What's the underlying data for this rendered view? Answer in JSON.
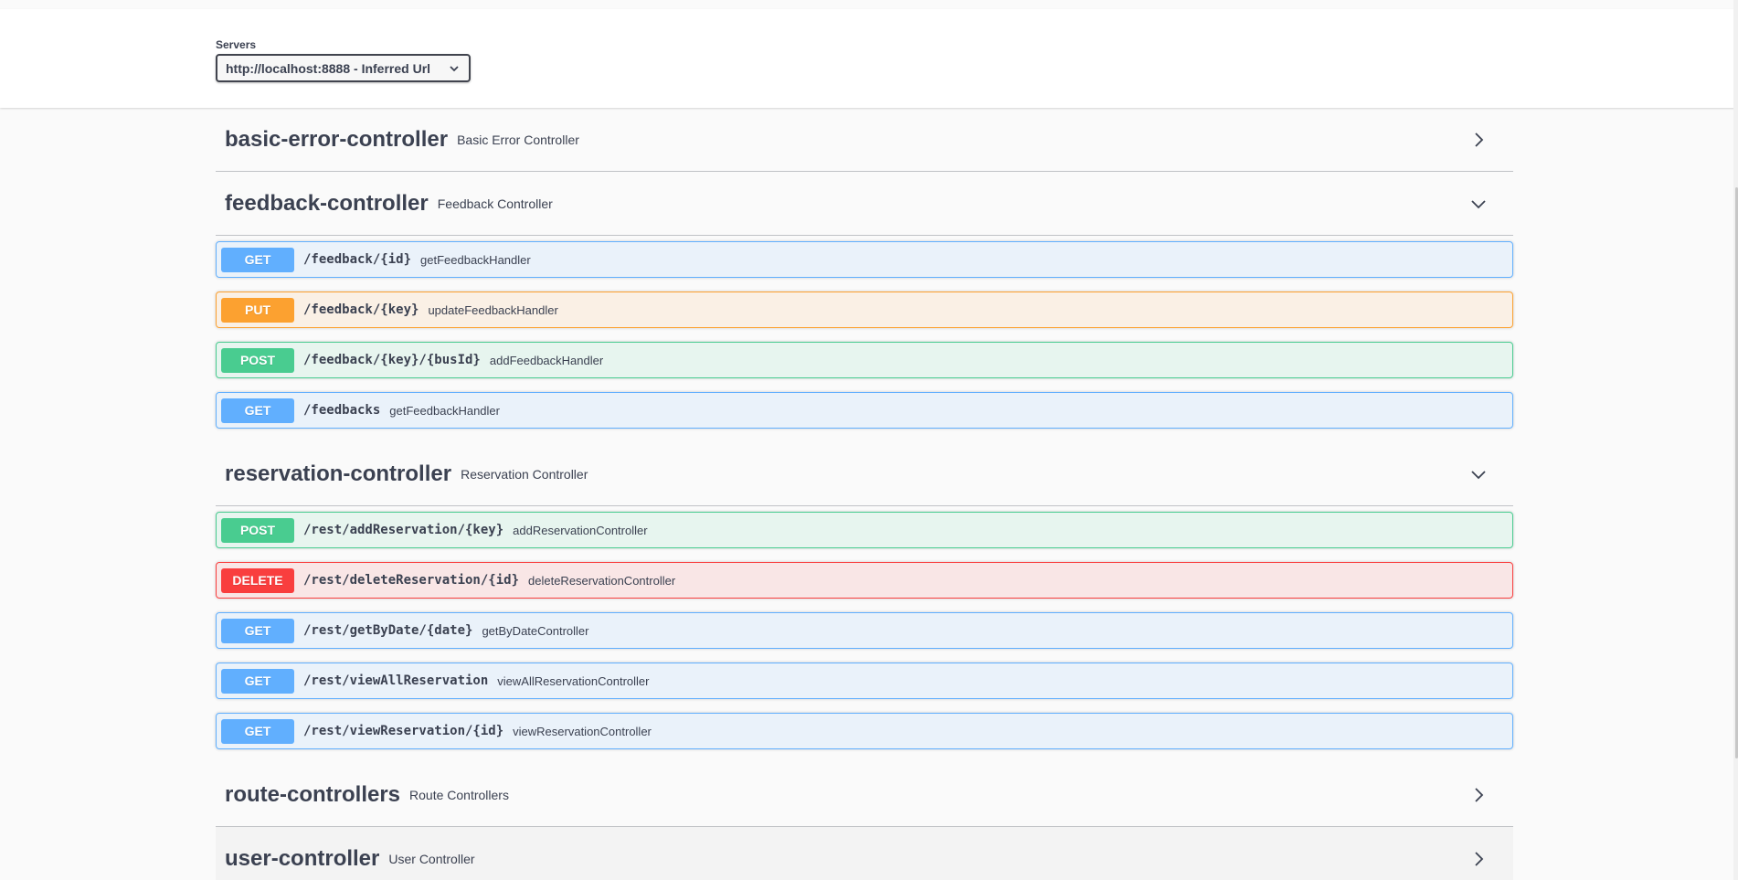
{
  "servers": {
    "label": "Servers",
    "selected": "http://localhost:8888 - Inferred Url"
  },
  "tags": [
    {
      "name": "basic-error-controller",
      "description": "Basic Error Controller",
      "expanded": false,
      "operations": []
    },
    {
      "name": "feedback-controller",
      "description": "Feedback Controller",
      "expanded": true,
      "operations": [
        {
          "method": "GET",
          "path": "/feedback/{id}",
          "summary": "getFeedbackHandler"
        },
        {
          "method": "PUT",
          "path": "/feedback/{key}",
          "summary": "updateFeedbackHandler"
        },
        {
          "method": "POST",
          "path": "/feedback/{key}/{busId}",
          "summary": "addFeedbackHandler"
        },
        {
          "method": "GET",
          "path": "/feedbacks",
          "summary": "getFeedbackHandler"
        }
      ]
    },
    {
      "name": "reservation-controller",
      "description": "Reservation Controller",
      "expanded": true,
      "operations": [
        {
          "method": "POST",
          "path": "/rest/addReservation/{key}",
          "summary": "addReservationController"
        },
        {
          "method": "DELETE",
          "path": "/rest/deleteReservation/{id}",
          "summary": "deleteReservationController"
        },
        {
          "method": "GET",
          "path": "/rest/getByDate/{date}",
          "summary": "getByDateController"
        },
        {
          "method": "GET",
          "path": "/rest/viewAllReservation",
          "summary": "viewAllReservationController"
        },
        {
          "method": "GET",
          "path": "/rest/viewReservation/{id}",
          "summary": "viewReservationController"
        }
      ]
    },
    {
      "name": "route-controllers",
      "description": "Route Controllers",
      "expanded": false,
      "operations": []
    },
    {
      "name": "user-controller",
      "description": "User Controller",
      "expanded": false,
      "operations": []
    }
  ],
  "colors": {
    "get": "#61affe",
    "put": "#fca130",
    "post": "#49cc90",
    "delete": "#f93e3e",
    "text": "#3b4151"
  }
}
